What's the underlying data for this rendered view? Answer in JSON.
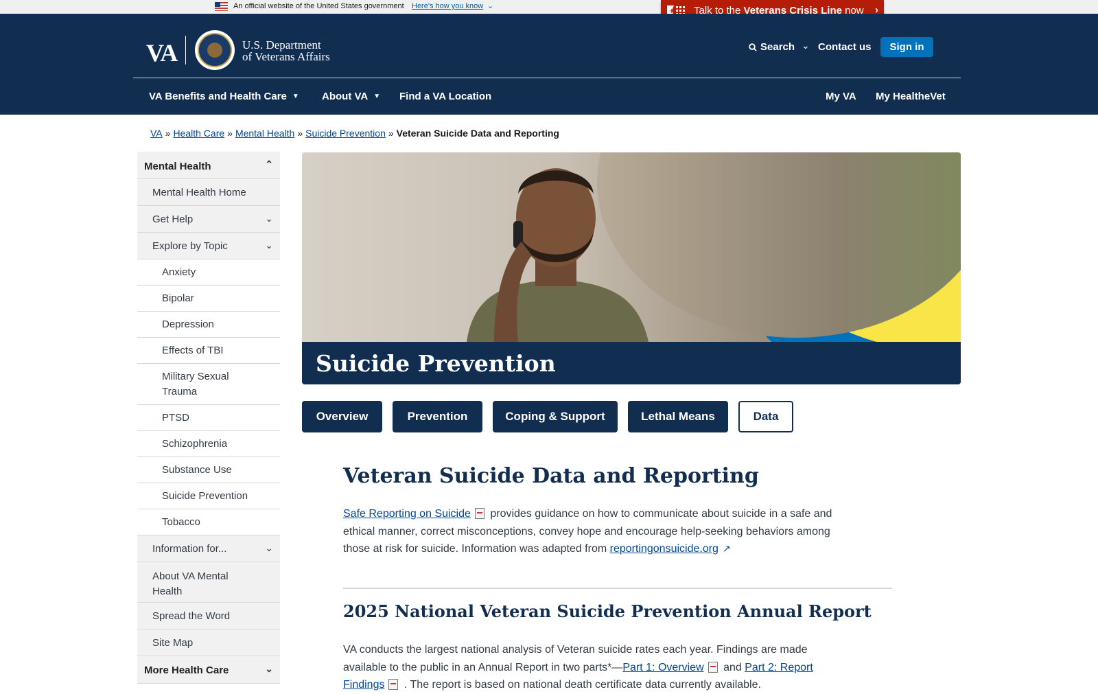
{
  "gov_banner": {
    "text": "An official website of the United States government",
    "link": "Here's how you know"
  },
  "crisis_line": {
    "prefix": "Talk to the ",
    "bold": "Veterans Crisis Line",
    "suffix": " now"
  },
  "header": {
    "logo_va": "VA",
    "logo_dept_line1": "U.S. Department",
    "logo_dept_line2": "of Veterans Affairs",
    "search": "Search",
    "contact": "Contact us",
    "signin": "Sign in"
  },
  "nav": {
    "benefits": "VA Benefits and Health Care",
    "about": "About VA",
    "find": "Find a VA Location",
    "myva": "My VA",
    "myhealthevet": "My HealtheVet"
  },
  "breadcrumb": [
    "VA",
    "Health Care",
    "Mental Health",
    "Suicide Prevention",
    "Veteran Suicide Data and Reporting"
  ],
  "sidebar": {
    "top": "Mental Health",
    "l1": [
      "Mental Health Home",
      "Get Help",
      "Explore by Topic"
    ],
    "topics": [
      "Anxiety",
      "Bipolar",
      "Depression",
      "Effects of TBI",
      "Military Sexual Trauma",
      "PTSD",
      "Schizophrenia",
      "Substance Use",
      "Suicide Prevention",
      "Tobacco"
    ],
    "l1_after": [
      "Information for...",
      "About VA Mental Health",
      "Spread the Word",
      "Site Map"
    ],
    "bottom": "More Health Care"
  },
  "hero": {
    "title": "Suicide Prevention"
  },
  "tabs": [
    "Overview",
    "Prevention",
    "Coping & Support",
    "Lethal Means",
    "Data"
  ],
  "content": {
    "title": "Veteran Suicide Data and Reporting",
    "p1_link": "Safe Reporting on Suicide",
    "p1_text": " provides guidance on how to communicate about suicide in a safe and ethical manner, correct misconceptions, convey hope and encourage help-seeking behaviors among those at risk for suicide. Information was adapted from ",
    "p1_link2": "reportingonsuicide.org",
    "h2": "2025 National Veteran Suicide Prevention Annual Report",
    "p2_text": "VA conducts the largest national analysis of Veteran suicide rates each year. Findings are made available to the public in an Annual Report in two parts*—",
    "p2_link1": "Part 1: Overview",
    "p2_and": " and",
    "p2_link2": "Part 2: Report Findings",
    "p2_tail": " . The report is based on national death certificate data currently available."
  },
  "colors": {
    "navy": "#112e51",
    "crisis_red": "#b51d09",
    "link": "#004795",
    "signin_blue": "#0071bb"
  }
}
